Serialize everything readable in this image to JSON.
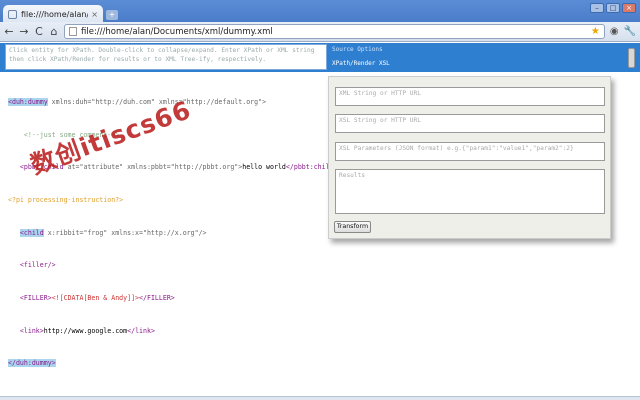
{
  "browser": {
    "tab_title": "file:///home/alan/Docum",
    "tab_close": "×",
    "new_tab": "+",
    "url": "file:///home/alan/Documents/xml/dummy.xml",
    "back": "←",
    "forward": "→",
    "reload": "C",
    "home": "⌂",
    "star": "★",
    "page_menu": "◉",
    "wrench": "🔧"
  },
  "extension": {
    "hint": "Click entity for XPath. Double-click to collapse/expand. Enter XPath or XML string then click XPath/Render for results or to XML Tree-ify, respectively.",
    "link_source_options": "Source Options",
    "link_xpath_render": "XPath/Render XSL"
  },
  "xml": {
    "l1_tag": "<duh:dummy",
    "l1_attrs": " xmlns:duh=\"http://duh.com\" xmlns=\"http://default.org\">",
    "l2": "<!--just some comment-->",
    "l3_open": "<pbbt:child",
    "l3_attrs": " at=\"attribute\" xmlns:pbbt=\"http://pbbt.org\">",
    "l3_text": "hello world",
    "l3_close": "</pbbt:child>",
    "l4": "<?pi processing-instruction?>",
    "l5_open": "<child",
    "l5_attrs": " x:ribbit=\"frog\" xmlns:x=\"http://x.org\"/>",
    "l6": "<filler/>",
    "l7_open": "<FILLER>",
    "l7_cdata": "<![CDATA[Ben & Andy]]>",
    "l7_close": "</FILLER>",
    "l8_open": "<link>",
    "l8_text": "http://www.google.com",
    "l8_close": "</link>",
    "l9": "</duh:dummy>"
  },
  "panel": {
    "xml_placeholder": "XML String or HTTP URL",
    "xsl_placeholder": "XSL String or HTTP URL",
    "params_placeholder": "XSL Parameters (JSON format) e.g.{\"param1\":\"value1\",\"param2\":2}",
    "results_placeholder": "Results",
    "transform_label": "Transform"
  },
  "watermark": "数创itiscs66"
}
